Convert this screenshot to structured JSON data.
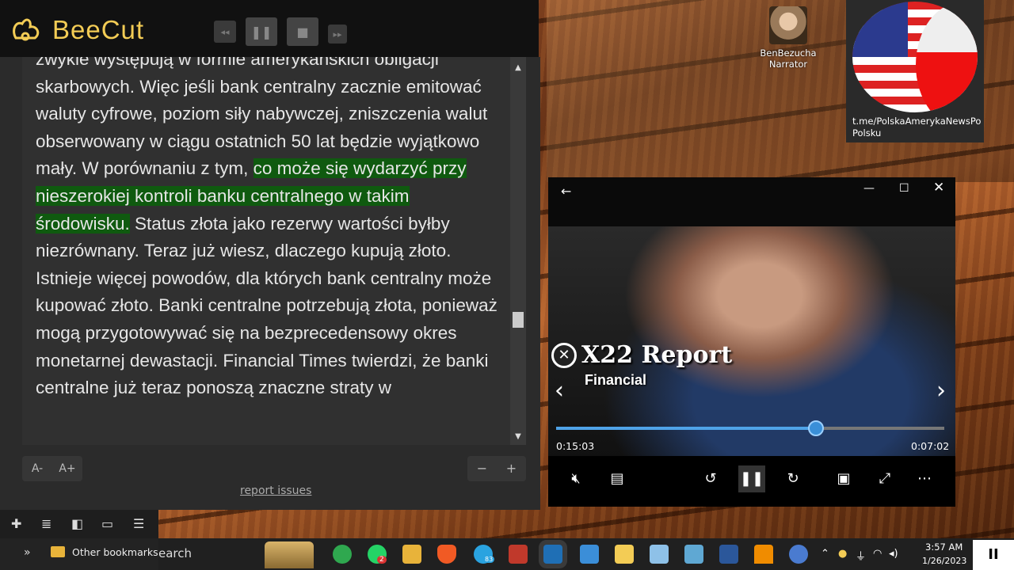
{
  "beecut": {
    "app_name": "BeeCut"
  },
  "reader": {
    "text_before": "zwykle występują w formie amerykańskich obligacji skarbowych. Więc jeśli bank centralny zacznie emitować waluty cyfrowe, poziom siły nabywczej, zniszczenia walut obserwowany w ciągu ostatnich 50 lat będzie wyjątkowo mały. W porównaniu z tym, ",
    "text_highlight": "co może się wydarzyć przy nieszerokiej kontroli banku centralnego w takim środowisku.",
    "text_after": " Status złota jako rezerwy wartości byłby niezrównany. Teraz już wiesz, dlaczego kupują złoto. Istnieje więcej powodów, dla których bank centralny może kupować złoto. Banki centralne potrzebują złota, ponieważ mogą przygotowywać się na bezprecedensowy okres monetarnej dewastacji. Financial Times twierdzi, że banki centralne już teraz ponoszą znaczne straty w",
    "font_decrease": "A-",
    "font_increase": "A+",
    "zoom_out": "−",
    "zoom_in": "+",
    "report_link": "report issues",
    "highlight_color": "#0f5a0f"
  },
  "narrator": {
    "name": "BenBezucha",
    "role": "Narrator"
  },
  "flag_tile": {
    "caption": "t.me/PolskaAmerykaNewsPo Polsku"
  },
  "player": {
    "video_brand": "X22 Report",
    "video_tagline": "Financial",
    "current_time": "0:15:03",
    "total_time": "0:07:02",
    "progress": 0.67,
    "accent": "#4fa3e8",
    "icons": [
      "back-icon",
      "minimize-icon",
      "maximize-icon",
      "close-icon",
      "prev-icon",
      "next-icon",
      "mute-icon",
      "subtitles-icon",
      "rewind-10-icon",
      "pause-icon",
      "forward-30-icon",
      "miniview-icon",
      "fullscreen-icon",
      "more-icon"
    ]
  },
  "bookmarks": {
    "folder_label": "Other bookmarks"
  },
  "taskbar": {
    "search_text": "earch",
    "time": "3:57 AM",
    "date": "1/26/2023",
    "whatsapp_badge": "2",
    "telegram_badge": "83",
    "pause_symbol": "II"
  }
}
